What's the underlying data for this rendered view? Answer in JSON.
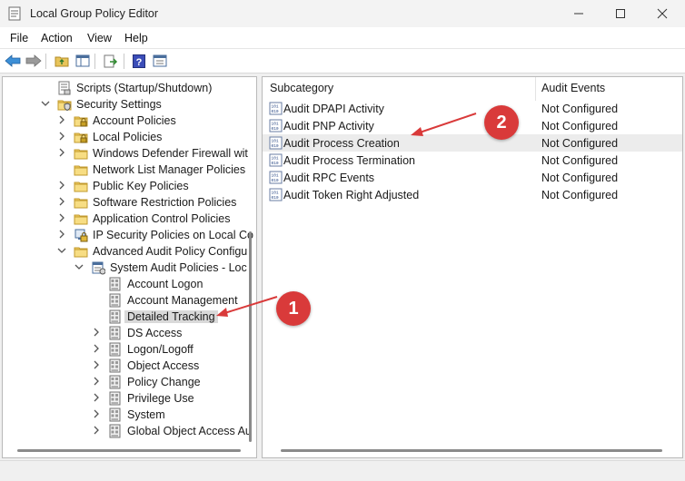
{
  "window": {
    "title": "Local Group Policy Editor"
  },
  "menu": [
    "File",
    "Action",
    "View",
    "Help"
  ],
  "toolbar_icons": [
    "back-arrow-icon",
    "forward-arrow-icon",
    "up-folder-icon",
    "show-hide-tree-icon",
    "export-list-icon",
    "help-icon",
    "properties-icon"
  ],
  "tree": {
    "items": [
      {
        "label": "Scripts (Startup/Shutdown)",
        "icon": "script-icon",
        "level": 2,
        "chevron": "none"
      },
      {
        "label": "Security Settings",
        "icon": "security-settings-icon",
        "level": 2,
        "chevron": "expanded"
      },
      {
        "label": "Account Policies",
        "icon": "folder-lock-icon",
        "level": 3,
        "chevron": "collapsed"
      },
      {
        "label": "Local Policies",
        "icon": "folder-lock-icon",
        "level": 3,
        "chevron": "collapsed"
      },
      {
        "label": "Windows Defender Firewall wit",
        "icon": "folder-icon",
        "level": 3,
        "chevron": "collapsed"
      },
      {
        "label": "Network List Manager Policies",
        "icon": "folder-icon",
        "level": 3,
        "chevron": "none"
      },
      {
        "label": "Public Key Policies",
        "icon": "folder-icon",
        "level": 3,
        "chevron": "collapsed"
      },
      {
        "label": "Software Restriction Policies",
        "icon": "folder-icon",
        "level": 3,
        "chevron": "collapsed"
      },
      {
        "label": "Application Control Policies",
        "icon": "folder-icon",
        "level": 3,
        "chevron": "collapsed"
      },
      {
        "label": "IP Security Policies on Local Co",
        "icon": "ip-security-icon",
        "level": 3,
        "chevron": "collapsed"
      },
      {
        "label": "Advanced Audit Policy Configu",
        "icon": "folder-icon",
        "level": 3,
        "chevron": "expanded"
      },
      {
        "label": "System Audit Policies - Loc",
        "icon": "audit-policies-icon",
        "level": 4,
        "chevron": "expanded"
      },
      {
        "label": "Account Logon",
        "icon": "policy-doc-icon",
        "level": 5,
        "chevron": "none"
      },
      {
        "label": "Account Management",
        "icon": "policy-doc-icon",
        "level": 5,
        "chevron": "none"
      },
      {
        "label": "Detailed Tracking",
        "icon": "policy-doc-icon",
        "level": 5,
        "chevron": "none",
        "selected": true
      },
      {
        "label": "DS Access",
        "icon": "policy-doc-icon",
        "level": 5,
        "chevron": "collapsed"
      },
      {
        "label": "Logon/Logoff",
        "icon": "policy-doc-icon",
        "level": 5,
        "chevron": "collapsed"
      },
      {
        "label": "Object Access",
        "icon": "policy-doc-icon",
        "level": 5,
        "chevron": "collapsed"
      },
      {
        "label": "Policy Change",
        "icon": "policy-doc-icon",
        "level": 5,
        "chevron": "collapsed"
      },
      {
        "label": "Privilege Use",
        "icon": "policy-doc-icon",
        "level": 5,
        "chevron": "collapsed"
      },
      {
        "label": "System",
        "icon": "policy-doc-icon",
        "level": 5,
        "chevron": "collapsed"
      },
      {
        "label": "Global Object Access Au",
        "icon": "policy-doc-icon",
        "level": 5,
        "chevron": "collapsed"
      }
    ]
  },
  "list": {
    "columns": [
      "Subcategory",
      "Audit Events"
    ],
    "rows": [
      {
        "name": "Audit DPAPI Activity",
        "value": "Not Configured"
      },
      {
        "name": "Audit PNP Activity",
        "value": "Not Configured"
      },
      {
        "name": "Audit Process Creation",
        "value": "Not Configured",
        "highlighted": true
      },
      {
        "name": "Audit Process Termination",
        "value": "Not Configured"
      },
      {
        "name": "Audit RPC Events",
        "value": "Not Configured"
      },
      {
        "name": "Audit Token Right Adjusted",
        "value": "Not Configured"
      }
    ]
  },
  "annotations": [
    {
      "label": "1",
      "color": "#d93a3a"
    },
    {
      "label": "2",
      "color": "#d93a3a"
    }
  ]
}
